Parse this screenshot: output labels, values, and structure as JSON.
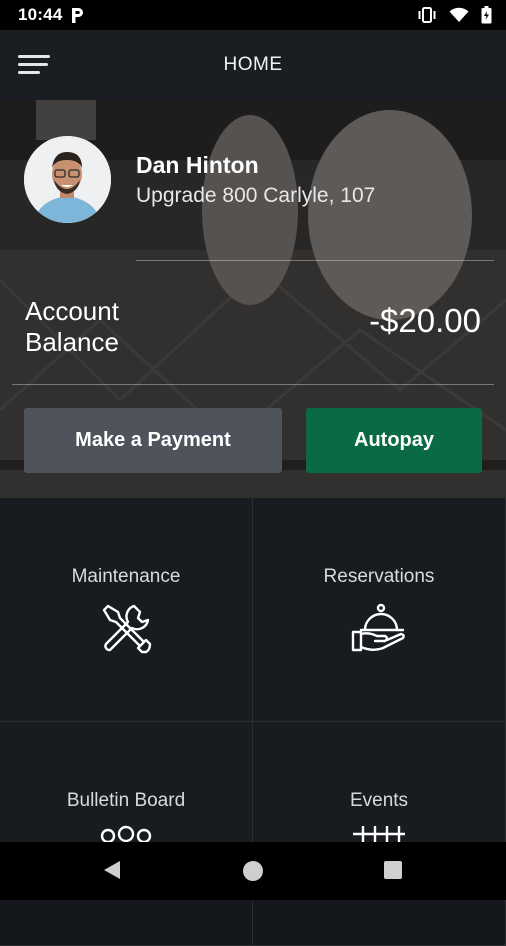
{
  "status_bar": {
    "time": "10:44"
  },
  "app_bar": {
    "title": "HOME"
  },
  "profile": {
    "name": "Dan Hinton",
    "unit": "Upgrade 800 Carlyle, 107"
  },
  "balance": {
    "label": "Account Balance",
    "value": "-$20.00"
  },
  "actions": {
    "pay_label": "Make a Payment",
    "autopay_label": "Autopay"
  },
  "tiles": [
    {
      "label": "Maintenance",
      "icon": "wrench-screwdriver-icon"
    },
    {
      "label": "Reservations",
      "icon": "service-bell-icon"
    },
    {
      "label": "Bulletin Board",
      "icon": "group-icon"
    },
    {
      "label": "Events",
      "icon": "calendar-icon"
    }
  ],
  "colors": {
    "autopay": "#0a6a46",
    "pay": "#4e535c",
    "background": "#14171b"
  }
}
